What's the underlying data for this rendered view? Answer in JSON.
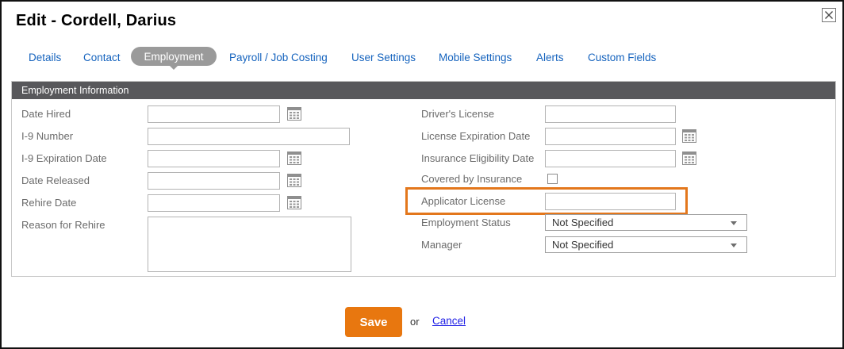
{
  "dialog": {
    "title": "Edit - Cordell, Darius"
  },
  "tabs": [
    {
      "label": "Details",
      "active": false
    },
    {
      "label": "Contact",
      "active": false
    },
    {
      "label": "Employment",
      "active": true
    },
    {
      "label": "Payroll / Job Costing",
      "active": false
    },
    {
      "label": "User Settings",
      "active": false
    },
    {
      "label": "Mobile Settings",
      "active": false
    },
    {
      "label": "Alerts",
      "active": false
    },
    {
      "label": "Custom Fields",
      "active": false
    }
  ],
  "section": {
    "title": "Employment Information"
  },
  "form": {
    "left": [
      {
        "label": "Date Hired",
        "type": "date",
        "value": ""
      },
      {
        "label": "I-9 Number",
        "type": "text",
        "value": ""
      },
      {
        "label": "I-9 Expiration Date",
        "type": "date",
        "value": ""
      },
      {
        "label": "Date Released",
        "type": "date",
        "value": ""
      },
      {
        "label": "Rehire Date",
        "type": "date",
        "value": ""
      },
      {
        "label": "Reason for Rehire",
        "type": "textarea",
        "value": ""
      }
    ],
    "right": [
      {
        "label": "Driver's License",
        "type": "text",
        "value": ""
      },
      {
        "label": "License Expiration Date",
        "type": "date",
        "value": ""
      },
      {
        "label": "Insurance Eligibility Date",
        "type": "date",
        "value": ""
      },
      {
        "label": "Covered by Insurance",
        "type": "checkbox",
        "checked": false
      },
      {
        "label": "Applicator License",
        "type": "text",
        "value": "",
        "highlighted": true
      },
      {
        "label": "Employment Status",
        "type": "select",
        "value": "Not Specified"
      },
      {
        "label": "Manager",
        "type": "select",
        "value": "Not Specified"
      }
    ]
  },
  "footer": {
    "save_label": "Save",
    "or_label": "or",
    "cancel_label": "Cancel"
  },
  "colors": {
    "accent_orange": "#e8770f",
    "highlight_orange": "#e3771c",
    "tab_blue": "#1563be",
    "active_tab_gray": "#9a9a9a",
    "section_header_gray": "#58585b",
    "link_blue": "#2222e6"
  }
}
